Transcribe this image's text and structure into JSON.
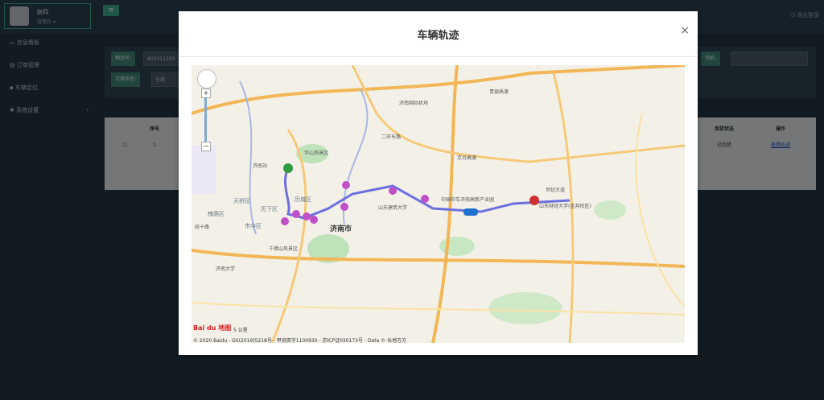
{
  "app": {
    "title": "车辆轨迹",
    "user_name": "赵四",
    "user_role": "管理员 ▾",
    "logout_label": "退出登录",
    "menu_toggle": "≡"
  },
  "sidebar": {
    "items": [
      {
        "label": "信息看板",
        "icon": "monitor-icon"
      },
      {
        "label": "订单管理",
        "icon": "order-icon"
      },
      {
        "label": "车辆定位",
        "icon": "car-icon"
      },
      {
        "label": "系统设置",
        "icon": "gear-icon"
      }
    ]
  },
  "filters": {
    "waybill_label": "物流号:",
    "waybill_value": "802011200",
    "status_label": "订单状态:",
    "status_value": "全部",
    "driver_label": "司机:"
  },
  "table": {
    "headers": [
      "序号",
      "到货状态",
      "操作"
    ],
    "row": {
      "index": "1",
      "status": "已到货",
      "action": "查看轨迹"
    }
  },
  "modal": {
    "title": "车辆轨迹",
    "close": "×"
  },
  "map": {
    "city_label": "济南市",
    "district_labels": [
      "历城区",
      "天桥区",
      "历下区",
      "市中区",
      "槐荫区"
    ],
    "place_labels": [
      "千佛山风景区",
      "山东建筑大学",
      "中国中车济南高新产业园",
      "山东财经大学(圣井校区)",
      "世纪大道",
      "济南大学",
      "华山风景区",
      "济南站",
      "济南国际机场"
    ],
    "road_labels": [
      "青银高速",
      "京台高速",
      "经十路",
      "二环东路"
    ],
    "logo": "Bai du 地图",
    "scale": "5 公里",
    "copyright": "© 2020 Baidu - GS(2019)5218号 - 甲测资字1100930 - 京ICP证030173号 - Data © 长地万方",
    "route_color": "#6d6fe0",
    "marker_color": "#c04fc8",
    "start_color": "#2e9b3e",
    "end_color": "#d03030"
  }
}
